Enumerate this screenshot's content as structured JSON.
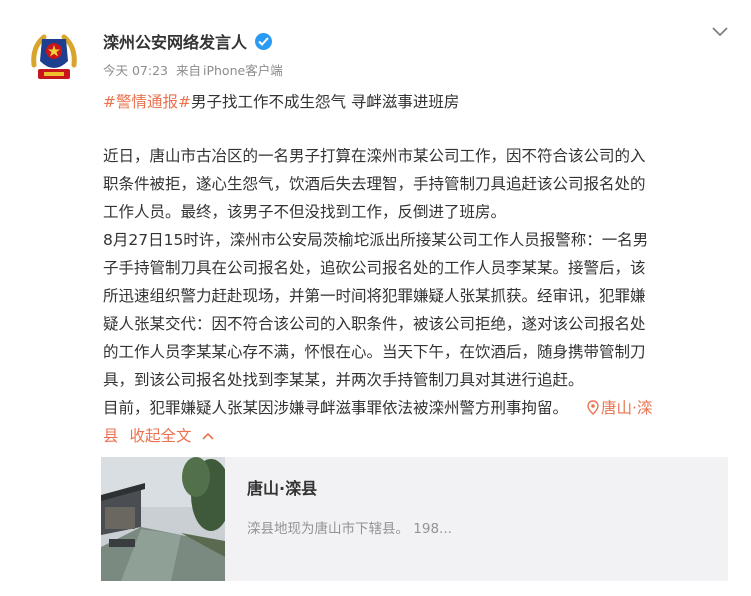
{
  "post": {
    "author": "滦州公安网络发言人",
    "time": "今天 07:23",
    "source_prefix": "来自",
    "source": "iPhone客户端",
    "hashtag": "#警情通报#",
    "headline": "男子找工作不成生怨气 寻衅滋事进班房",
    "lines": [
      "近日，唐山市古冶区的一名男子打算在滦州市某公司工作，因不符合该公司的入",
      "职条件被拒，遂心生怨气，饮酒后失去理智，手持管制刀具追赶该公司报名处的",
      "工作人员。最终，该男子不但没找到工作，反倒进了班房。",
      "8月27日15时许，滦州市公安局茨榆坨派出所接某公司工作人员报警称：一名男",
      "子手持管制刀具在公司报名处，追砍公司报名处的工作人员李某某。接警后，该",
      "所迅速组织警力赶赴现场，并第一时间将犯罪嫌疑人张某抓获。经审讯，犯罪嫌",
      "疑人张某交代：因不符合该公司的入职条件，被该公司拒绝，遂对该公司报名处",
      "的工作人员李某某心存不满，怀恨在心。当天下午，在饮酒后，随身携带管制刀",
      "具，到该公司报名处找到李某某，并两次手持管制刀具对其进行追赶。"
    ],
    "last_line_text": "目前，犯罪嫌疑人张某因涉嫌寻衅滋事罪依法被滦州警方刑事拘留。",
    "location_line1": "唐山·滦",
    "location_line2": "县",
    "collapse_label": "收起全文"
  },
  "card": {
    "title": "唐山·滦县",
    "description": "滦县地现为唐山市下辖县。 198..."
  },
  "colors": {
    "accent": "#eb7350",
    "verified": "#2a9af3",
    "card_bg": "#f2f2f5"
  }
}
